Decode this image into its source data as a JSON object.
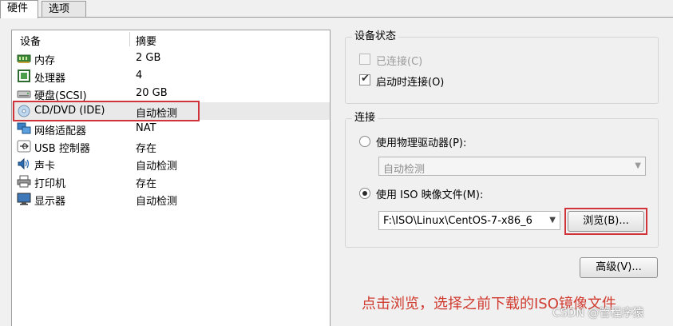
{
  "tabs": {
    "hardware": "硬件",
    "options": "选项"
  },
  "device_list": {
    "columns": {
      "device": "设备",
      "summary": "摘要"
    },
    "rows": [
      {
        "icon": "memory-icon",
        "name": "内存",
        "summary": "2 GB"
      },
      {
        "icon": "processor-icon",
        "name": "处理器",
        "summary": "4"
      },
      {
        "icon": "hard-disk-icon",
        "name": "硬盘(SCSI)",
        "summary": "20 GB"
      },
      {
        "icon": "cd-dvd-icon",
        "name": "CD/DVD (IDE)",
        "summary": "自动检测",
        "selected": true
      },
      {
        "icon": "network-adapter-icon",
        "name": "网络适配器",
        "summary": "NAT"
      },
      {
        "icon": "usb-icon",
        "name": "USB 控制器",
        "summary": "存在"
      },
      {
        "icon": "sound-card-icon",
        "name": "声卡",
        "summary": "自动检测"
      },
      {
        "icon": "printer-icon",
        "name": "打印机",
        "summary": "存在"
      },
      {
        "icon": "display-icon",
        "name": "显示器",
        "summary": "自动检测"
      }
    ]
  },
  "device_status": {
    "title": "设备状态",
    "connected": {
      "label": "已连接(C)",
      "checked": false,
      "disabled": true
    },
    "connect_at_power_on": {
      "label": "启动时连接(O)",
      "checked": true
    }
  },
  "connection": {
    "title": "连接",
    "use_physical_drive": {
      "label": "使用物理驱动器(P):",
      "selected": false
    },
    "physical_drive_combo": {
      "value": "自动检测",
      "disabled": true
    },
    "use_iso_image": {
      "label": "使用 ISO 映像文件(M):",
      "selected": true
    },
    "iso_path_combo": {
      "value": "F:\\ISO\\Linux\\CentOS-7-x86_6"
    },
    "browse_button": "浏览(B)..."
  },
  "advanced_button": "高级(V)...",
  "annotation_text": "点击浏览，选择之前下载的ISO镜像文件",
  "watermark": "CSDN @管程序猿",
  "colors": {
    "highlight_red": "#d0343a",
    "annotation_red": "#d03a2e"
  }
}
